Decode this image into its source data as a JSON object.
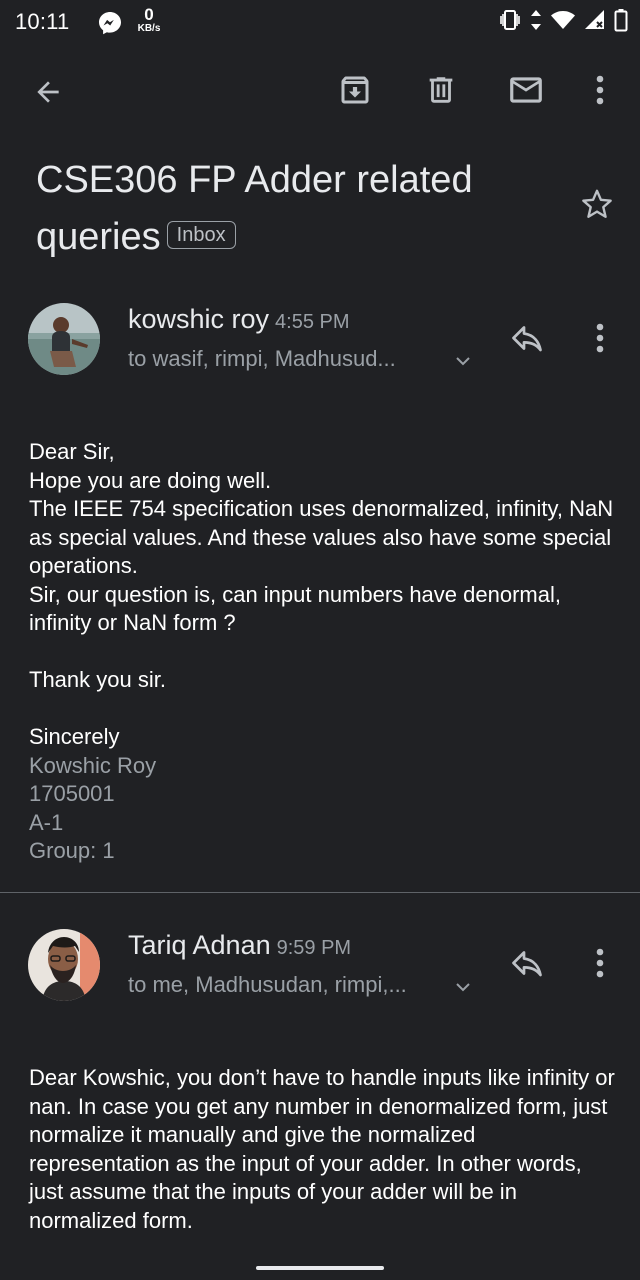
{
  "status_bar": {
    "time": "10:11",
    "net_speed_value": "0",
    "net_speed_unit": "KB/s",
    "icons": [
      "messenger-icon",
      "vibrate-icon",
      "data-arrows-icon",
      "wifi-icon",
      "signal-icon",
      "battery-icon"
    ]
  },
  "toolbar": {
    "icons": [
      "back-arrow-icon",
      "archive-icon",
      "delete-icon",
      "mail-icon",
      "more-vert-icon"
    ]
  },
  "email": {
    "subject": "CSE306 FP Adder related queries",
    "label": "Inbox"
  },
  "messages": [
    {
      "sender": "kowshic roy",
      "time": "4:55 PM",
      "recipients": "to wasif, rimpi, Madhusud...",
      "body": "Dear Sir,\nHope you are doing well.\nThe IEEE 754 specification uses denormalized, infinity, NaN as special values. And these values also have some special operations.\nSir, our question is, can input numbers have denormal, infinity or NaN form ?\n\nThank you sir.\n\nSincerely",
      "signature": "Kowshic Roy\n1705001\nA-1\nGroup: 1"
    },
    {
      "sender": "Tariq Adnan",
      "time": "9:59 PM",
      "recipients": "to me, Madhusudan, rimpi,...",
      "body": "Dear Kowshic, you don’t have to handle inputs like infinity or nan. In case you get any number in denormalized form, just normalize it manually and give the normalized representation as the input of your adder. In other words, just assume that the inputs of your adder will be in normalized form."
    }
  ],
  "colors": {
    "background": "#202124",
    "text_primary": "#e8eaed",
    "text_secondary": "#9aa0a6"
  }
}
